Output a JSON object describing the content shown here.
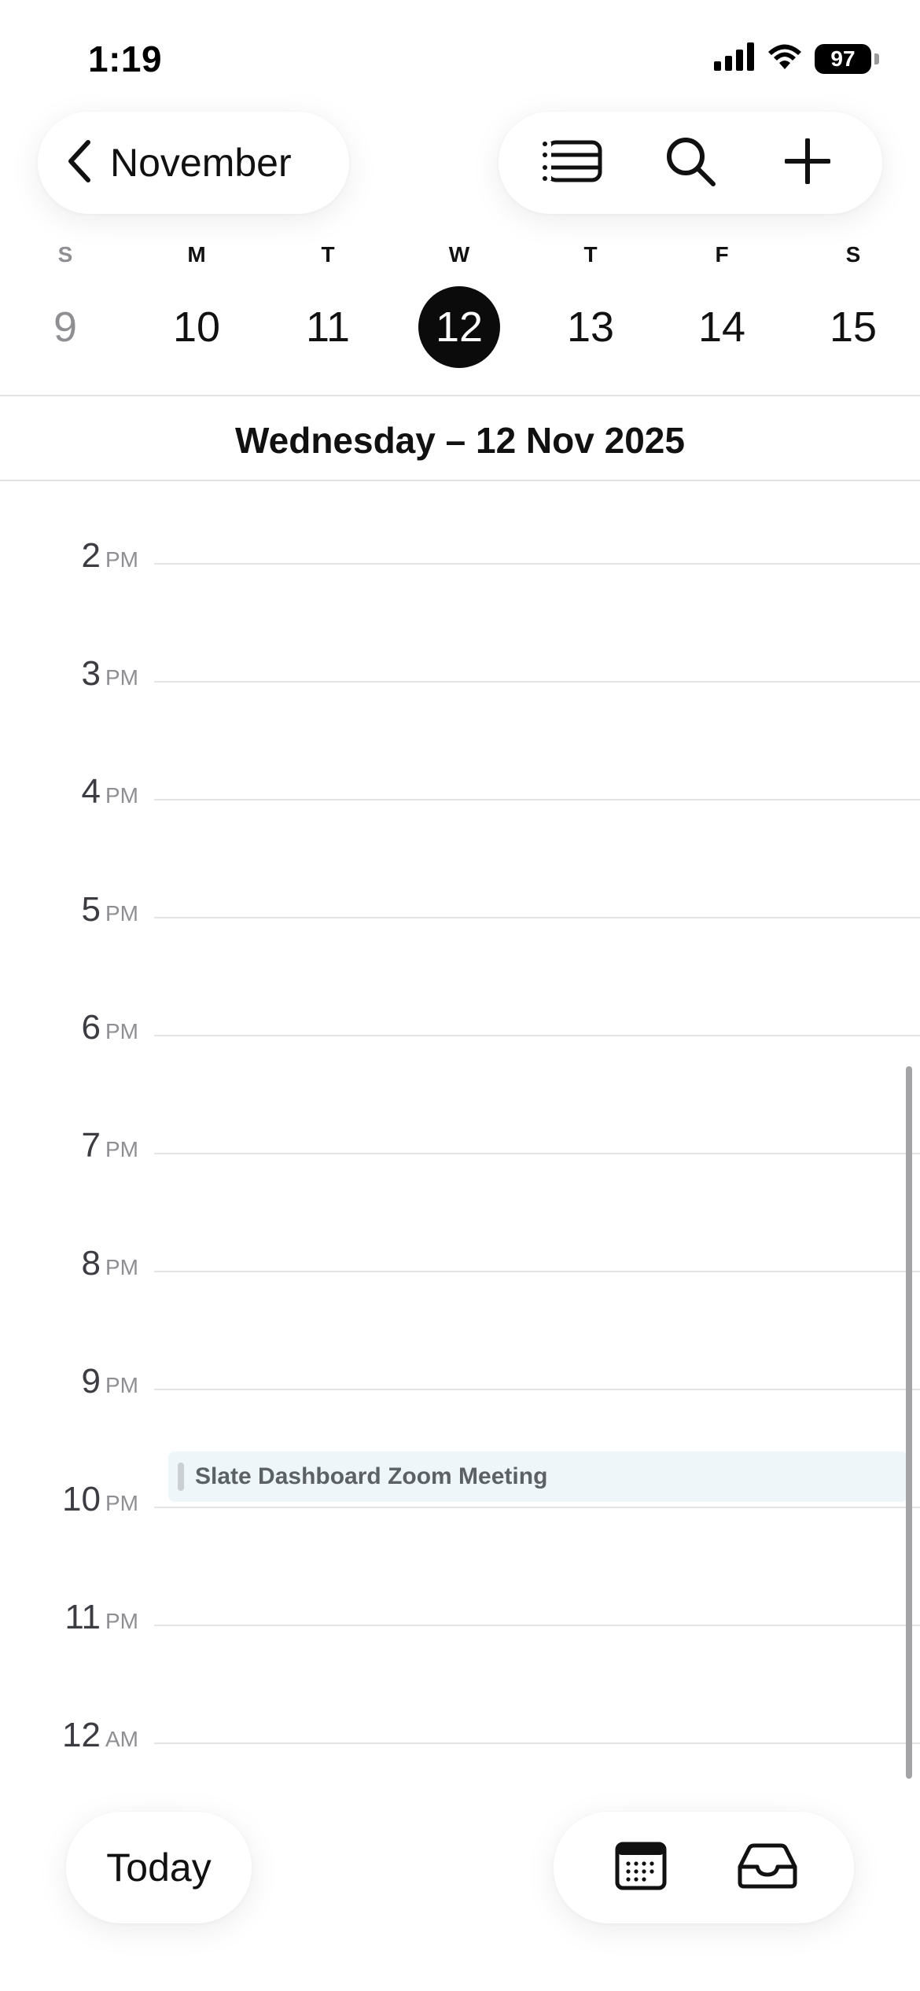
{
  "status_bar": {
    "time": "1:19",
    "battery": "97",
    "icons": [
      "cellular-signal-icon",
      "wifi-icon",
      "battery-icon"
    ]
  },
  "header": {
    "month_label": "November",
    "actions": [
      "list-view-icon",
      "search-icon",
      "add-icon"
    ]
  },
  "week": {
    "days": [
      {
        "dow": "S",
        "num": "9",
        "state": "muted"
      },
      {
        "dow": "M",
        "num": "10",
        "state": "normal"
      },
      {
        "dow": "T",
        "num": "11",
        "state": "normal"
      },
      {
        "dow": "W",
        "num": "12",
        "state": "selected"
      },
      {
        "dow": "T",
        "num": "13",
        "state": "normal"
      },
      {
        "dow": "F",
        "num": "14",
        "state": "normal"
      },
      {
        "dow": "S",
        "num": "15",
        "state": "normal"
      }
    ]
  },
  "date_title": "Wednesday – 12 Nov 2025",
  "timeline": {
    "hours": [
      {
        "hour": "2",
        "ampm": "PM"
      },
      {
        "hour": "3",
        "ampm": "PM"
      },
      {
        "hour": "4",
        "ampm": "PM"
      },
      {
        "hour": "5",
        "ampm": "PM"
      },
      {
        "hour": "6",
        "ampm": "PM"
      },
      {
        "hour": "7",
        "ampm": "PM"
      },
      {
        "hour": "8",
        "ampm": "PM"
      },
      {
        "hour": "9",
        "ampm": "PM"
      },
      {
        "hour": "10",
        "ampm": "PM"
      },
      {
        "hour": "11",
        "ampm": "PM"
      },
      {
        "hour": "12",
        "ampm": "AM"
      }
    ],
    "events": [
      {
        "title": "Slate Dashboard Zoom Meeting"
      }
    ]
  },
  "bottom_bar": {
    "today_label": "Today",
    "actions": [
      "calendar-icon",
      "inbox-icon"
    ]
  },
  "colors": {
    "selected_day_bg": "#0b0b0b",
    "event_bg": "#eef6fa",
    "event_text": "#5c6166",
    "grid_line": "#e4e4e6",
    "muted_text": "#8e8e93"
  }
}
